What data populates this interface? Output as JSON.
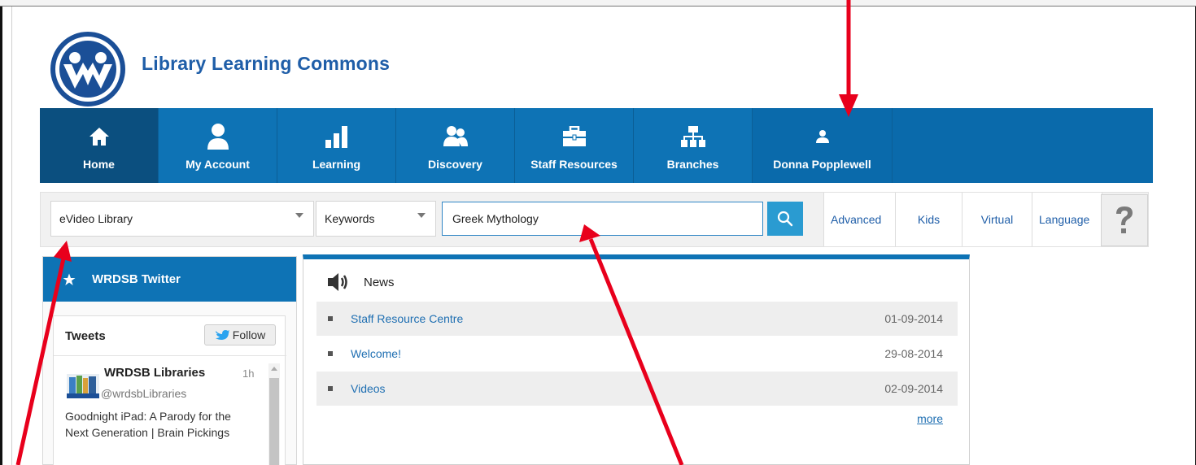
{
  "site": {
    "title": "Library Learning Commons"
  },
  "nav": {
    "items": [
      {
        "label": "Home",
        "icon": "home-icon"
      },
      {
        "label": "My Account",
        "icon": "person-icon"
      },
      {
        "label": "Learning",
        "icon": "bar-chart-icon"
      },
      {
        "label": "Discovery",
        "icon": "users-icon"
      },
      {
        "label": "Staff Resources",
        "icon": "briefcase-icon"
      },
      {
        "label": "Branches",
        "icon": "sitemap-icon"
      }
    ],
    "user": {
      "label": "Donna Popplewell",
      "icon": "user-icon"
    }
  },
  "search": {
    "library_select": "eVideo Library",
    "field_select": "Keywords",
    "query": "Greek Mythology",
    "links": [
      "Advanced",
      "Kids",
      "Virtual",
      "Language"
    ],
    "help_icon": "question-mark-icon"
  },
  "twitter": {
    "header": "WRDSB Twitter",
    "tweets_title": "Tweets",
    "follow_label": "Follow",
    "tweet": {
      "name": "WRDSB Libraries",
      "time": "1h",
      "handle": "@wrdsbLibraries",
      "text": "Goodnight iPad: A Parody for the Next Generation | Brain Pickings"
    }
  },
  "news": {
    "header": "News",
    "items": [
      {
        "title": "Staff Resource Centre",
        "date": "01-09-2014"
      },
      {
        "title": "Welcome!",
        "date": "29-08-2014"
      },
      {
        "title": "Videos",
        "date": "02-09-2014"
      }
    ],
    "more_label": "more"
  },
  "colors": {
    "nav_blue": "#0e73b5",
    "nav_active": "#0b4f7f",
    "link_blue": "#1f6fb2",
    "annotation_red": "#e8001c"
  }
}
